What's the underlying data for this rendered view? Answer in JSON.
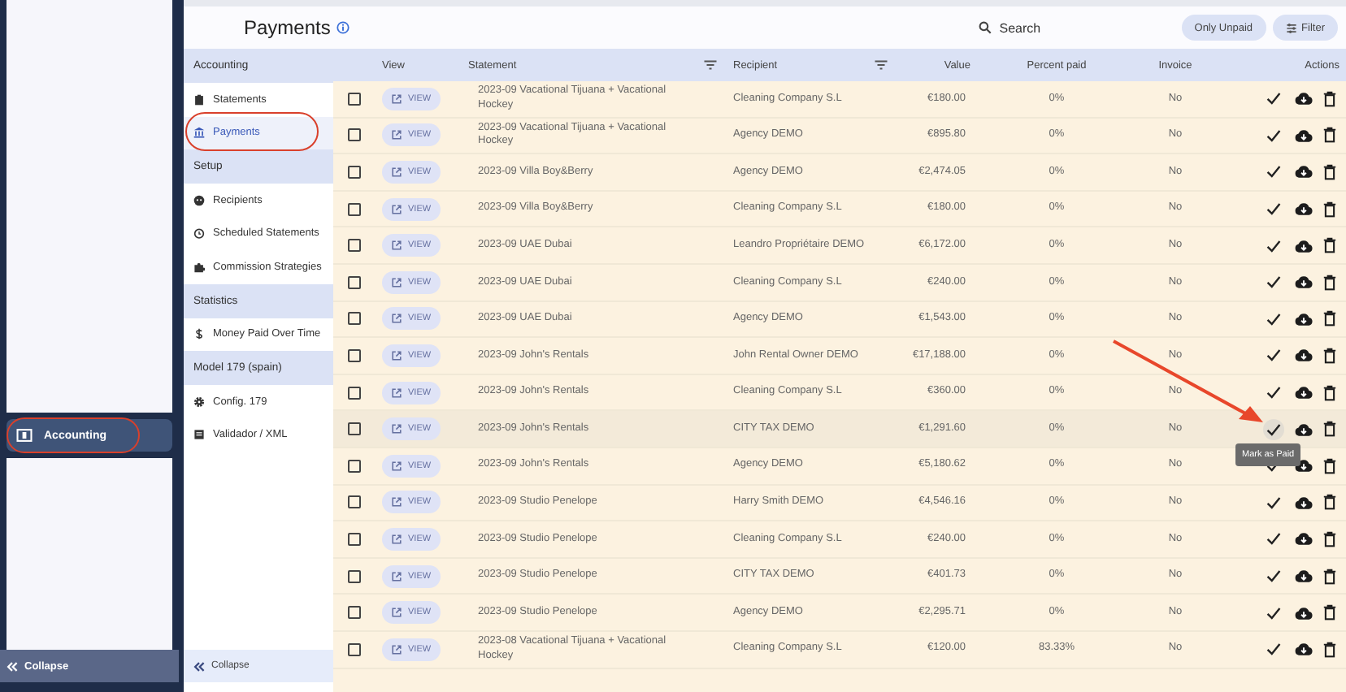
{
  "rail": {
    "items": [
      {
        "label": "Accounting",
        "selected": true,
        "circled": true
      }
    ],
    "collapse": "Collapse"
  },
  "header": {
    "title": "Payments",
    "search": {
      "placeholder": "Search"
    },
    "buttons": [
      "Only Unpaid",
      "Filter"
    ]
  },
  "nav": {
    "sections": [
      {
        "title": "Accounting",
        "items": [
          {
            "label": "Statements",
            "selected": false,
            "circled": false
          },
          {
            "label": "Payments",
            "selected": true,
            "circled": true
          }
        ]
      },
      {
        "title": "Setup",
        "items": [
          {
            "label": "Recipients",
            "selected": false,
            "circled": false
          },
          {
            "label": "Scheduled Statements",
            "selected": false,
            "circled": false
          },
          {
            "label": "Commission Strategies",
            "selected": false,
            "circled": false
          }
        ]
      },
      {
        "title": "Statistics",
        "items": [
          {
            "label": "Money Paid Over Time",
            "selected": false,
            "circled": false
          }
        ]
      },
      {
        "title": "Model 179 (spain)",
        "items": [
          {
            "label": "Config. 179",
            "selected": false,
            "circled": false
          },
          {
            "label": "Validador / XML",
            "selected": false,
            "circled": false
          }
        ]
      }
    ],
    "collapse": "Collapse"
  },
  "table": {
    "columns": [
      "View",
      "Statement",
      "Recipient",
      "Value",
      "Percent paid",
      "Invoice",
      "Actions"
    ],
    "rows": [
      {
        "checked": false,
        "view": "VIEW",
        "statement": "2023-09 Vacational Tijuana + Vacational Hockey",
        "recipient": "Cleaning Company S.L",
        "value": "€180.00",
        "percent": "0%",
        "invoice": "No",
        "hovered": false
      },
      {
        "checked": false,
        "view": "VIEW",
        "statement": "2023-09 Vacational Tijuana + Vacational Hockey",
        "recipient": "Agency DEMO",
        "value": "€895.80",
        "percent": "0%",
        "invoice": "No",
        "hovered": false
      },
      {
        "checked": false,
        "view": "VIEW",
        "statement": "2023-09 Villa Boy&Berry",
        "recipient": "Agency DEMO",
        "value": "€2,474.05",
        "percent": "0%",
        "invoice": "No",
        "hovered": false
      },
      {
        "checked": false,
        "view": "VIEW",
        "statement": "2023-09 Villa Boy&Berry",
        "recipient": "Cleaning Company S.L",
        "value": "€180.00",
        "percent": "0%",
        "invoice": "No",
        "hovered": false
      },
      {
        "checked": false,
        "view": "VIEW",
        "statement": "2023-09 UAE Dubai",
        "recipient": "Leandro Propriétaire DEMO",
        "value": "€6,172.00",
        "percent": "0%",
        "invoice": "No",
        "hovered": false
      },
      {
        "checked": false,
        "view": "VIEW",
        "statement": "2023-09 UAE Dubai",
        "recipient": "Cleaning Company S.L",
        "value": "€240.00",
        "percent": "0%",
        "invoice": "No",
        "hovered": false
      },
      {
        "checked": false,
        "view": "VIEW",
        "statement": "2023-09 UAE Dubai",
        "recipient": "Agency DEMO",
        "value": "€1,543.00",
        "percent": "0%",
        "invoice": "No",
        "hovered": false
      },
      {
        "checked": false,
        "view": "VIEW",
        "statement": "2023-09 John's Rentals",
        "recipient": "John Rental Owner DEMO",
        "value": "€17,188.00",
        "percent": "0%",
        "invoice": "No",
        "hovered": false
      },
      {
        "checked": false,
        "view": "VIEW",
        "statement": "2023-09 John's Rentals",
        "recipient": "Cleaning Company S.L",
        "value": "€360.00",
        "percent": "0%",
        "invoice": "No",
        "hovered": false
      },
      {
        "checked": false,
        "view": "VIEW",
        "statement": "2023-09 John's Rentals",
        "recipient": "CITY TAX DEMO",
        "value": "€1,291.60",
        "percent": "0%",
        "invoice": "No",
        "hovered": true,
        "tooltip": "Mark as Paid",
        "arrow": true
      },
      {
        "checked": false,
        "view": "VIEW",
        "statement": "2023-09 John's Rentals",
        "recipient": "Agency DEMO",
        "value": "€5,180.62",
        "percent": "0%",
        "invoice": "No",
        "hovered": false
      },
      {
        "checked": false,
        "view": "VIEW",
        "statement": "2023-09 Studio Penelope",
        "recipient": "Harry Smith DEMO",
        "value": "€4,546.16",
        "percent": "0%",
        "invoice": "No",
        "hovered": false
      },
      {
        "checked": false,
        "view": "VIEW",
        "statement": "2023-09 Studio Penelope",
        "recipient": "Cleaning Company S.L",
        "value": "€240.00",
        "percent": "0%",
        "invoice": "No",
        "hovered": false
      },
      {
        "checked": false,
        "view": "VIEW",
        "statement": "2023-09 Studio Penelope",
        "recipient": "CITY TAX DEMO",
        "value": "€401.73",
        "percent": "0%",
        "invoice": "No",
        "hovered": false
      },
      {
        "checked": false,
        "view": "VIEW",
        "statement": "2023-09 Studio Penelope",
        "recipient": "Agency DEMO",
        "value": "€2,295.71",
        "percent": "0%",
        "invoice": "No",
        "hovered": false
      },
      {
        "checked": false,
        "view": "VIEW",
        "statement": "2023-08 Vacational Tijuana + Vacational Hockey",
        "recipient": "Cleaning Company S.L",
        "value": "€120.00",
        "percent": "83.33%",
        "invoice": "No",
        "hovered": false
      }
    ]
  }
}
